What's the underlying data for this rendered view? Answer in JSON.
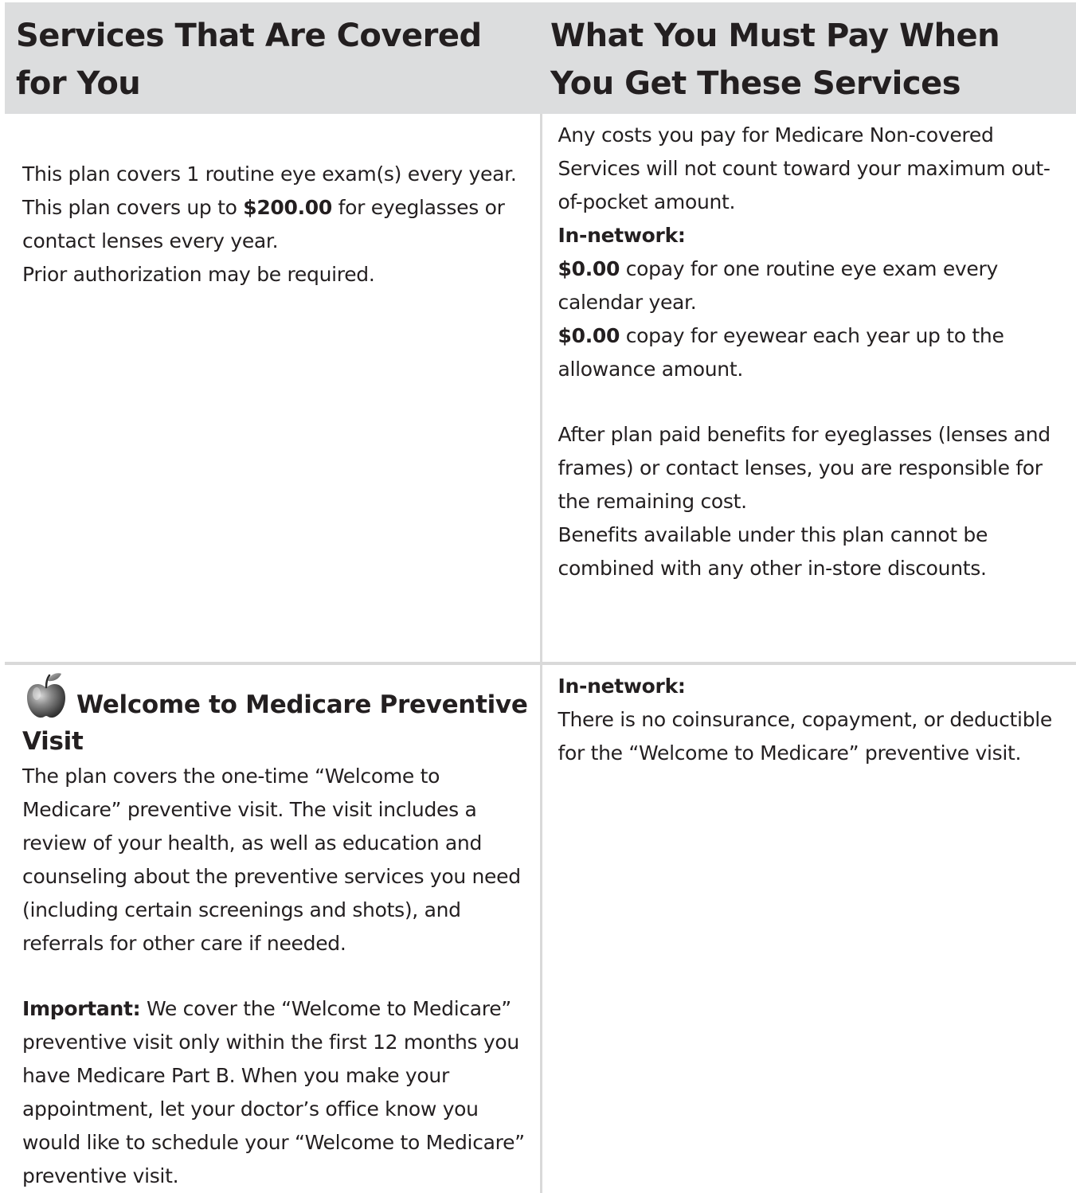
{
  "header": {
    "col1": "Services That Are Covered for You",
    "col2": "What You Must Pay When You Get These Services"
  },
  "vision": {
    "left": {
      "line1": "This plan covers 1 routine eye exam(s) every year.",
      "line2_pre": "This plan covers up to ",
      "line2_amount": "$200.00",
      "line2_post": " for eyeglasses or contact lenses every year.",
      "line3": "Prior authorization may be required."
    },
    "right": {
      "note": "Any costs you pay for Medicare Non-covered Services will not count toward your maximum out-of-pocket amount.",
      "in_network_label": "In-network:",
      "exam_amount": "$0.00",
      "exam_text": " copay for one routine eye exam every calendar year.",
      "eyewear_amount": "$0.00",
      "eyewear_text": " copay for eyewear each year up to the allowance amount.",
      "after_plan": "After plan paid benefits for eyeglasses (lenses and frames) or contact lenses, you are responsible for the remaining cost.",
      "combined": "Benefits available under this plan cannot be combined with any other in-store discounts."
    }
  },
  "welcome": {
    "left": {
      "icon": "apple-icon",
      "title": "Welcome to Medicare Preventive Visit",
      "description": "The plan covers the one-time “Welcome to Medicare” preventive visit. The visit includes a review of your health, as well as education and counseling about the preventive services you need (including certain screenings and shots), and referrals for other care if needed.",
      "important_label": "Important:",
      "important_text": " We cover the “Welcome to Medicare” preventive visit only within the first 12 months you have Medicare Part B. When you make your appointment, let your doctor’s office know you would like to schedule your “Welcome to Medicare” preventive visit."
    },
    "right": {
      "in_network_label": "In-network:",
      "text": "There is no coinsurance, copayment, or deductible for the “Welcome to Medicare” preventive visit."
    }
  },
  "colors": {
    "header_bg": "#dcddde",
    "border": "#d9d9d9",
    "text": "#231f20"
  }
}
